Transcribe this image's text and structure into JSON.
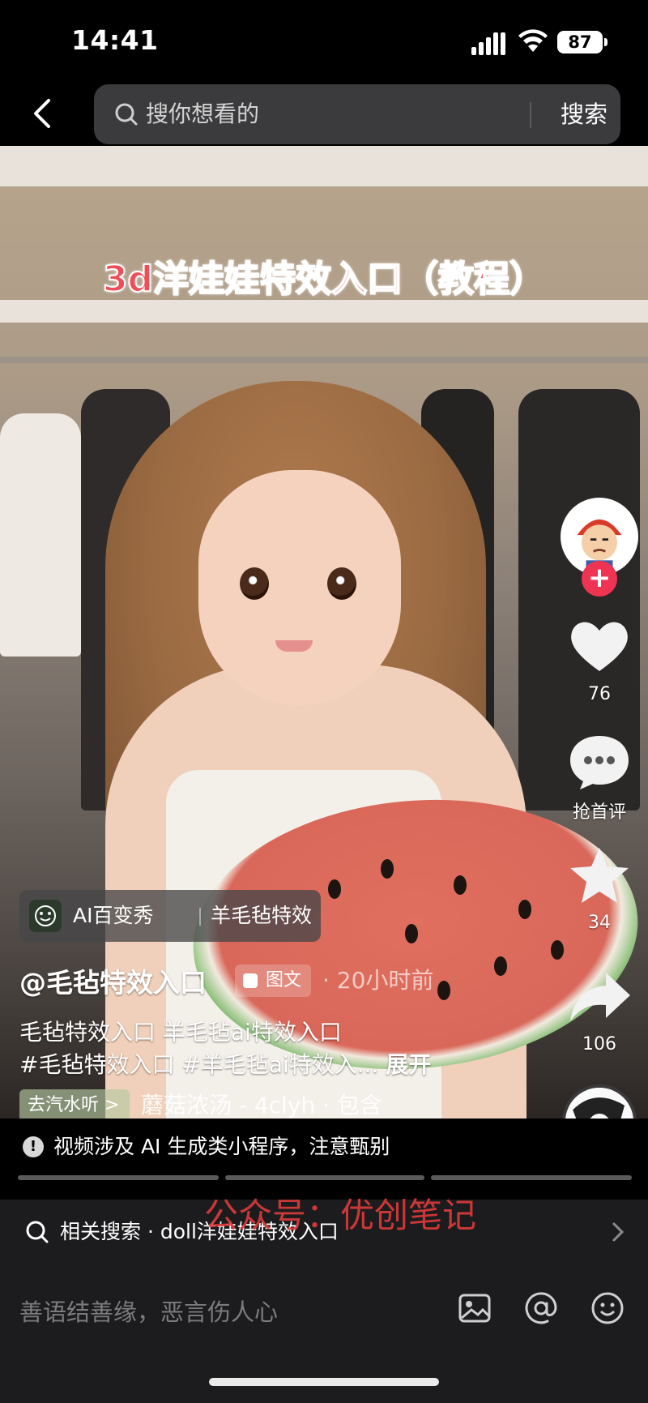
{
  "status_bar": {
    "time": "14:41",
    "battery": "87"
  },
  "top_bar": {
    "search_placeholder": "搜你想看的",
    "search_button": "搜索"
  },
  "video": {
    "overlay_title": "3d洋娃娃特效入口（教程）"
  },
  "right_rail": {
    "likes": "76",
    "comments": "抢首评",
    "favorites": "34",
    "shares": "106"
  },
  "info": {
    "effect_tag": {
      "name": "AI百变秀",
      "sub": "羊毛毡特效"
    },
    "author": "@毛毡特效入口",
    "type_badge": "图文",
    "time": "· 20小时前",
    "desc_line1": "毛毡特效入口 羊毛毡ai特效入口",
    "desc_line2": "#毛毡特效入口 #羊毛毡ai特效入...",
    "expand": "展开",
    "listen_button": "去汽水听 >",
    "music_title": "蘑菇浓汤 - 4clyh · 包含"
  },
  "notice": {
    "text": "视频涉及 AI 生成类小程序，注意甄别"
  },
  "related": {
    "text": "相关搜索 · doll洋娃娃特效入口"
  },
  "watermark": "公众号：优创笔记",
  "comment_bar": {
    "placeholder": "善语结善缘，恶言伤人心"
  },
  "progress_segments": 3,
  "colors": {
    "accent": "#ee3452",
    "title_red": "#ef4d58"
  }
}
